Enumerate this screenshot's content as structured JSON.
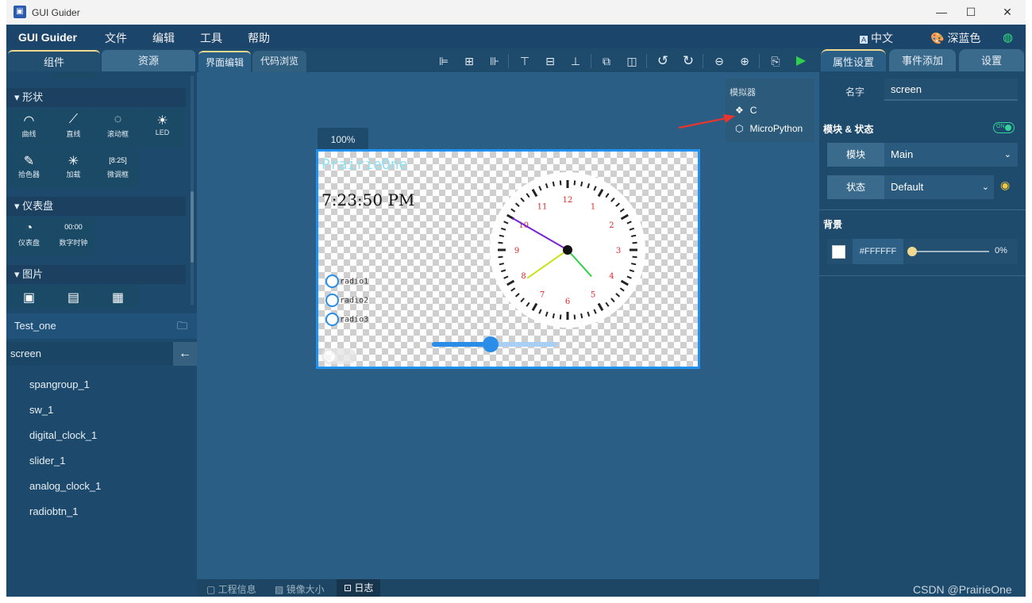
{
  "window": {
    "title": "GUI Guider",
    "icon": "app-logo-icon"
  },
  "menubar": {
    "brand": "GUI Guider",
    "items": [
      "文件",
      "编辑",
      "工具",
      "帮助"
    ],
    "language": "中文",
    "theme": "深蓝色"
  },
  "left_panel": {
    "tabs": [
      "组件",
      "资源"
    ],
    "sections": [
      {
        "title": "形状",
        "items": [
          "曲线",
          "直线",
          "滚动框",
          "LED",
          "拾色器",
          "加载",
          "微调框"
        ]
      },
      {
        "title": "仪表盘",
        "items": [
          "仪表盘",
          "数字时钟"
        ]
      },
      {
        "title": "图片",
        "items": [
          "",
          "",
          ""
        ]
      }
    ],
    "project": "Test_one",
    "screen": "screen",
    "tree": [
      "spangroup_1",
      "sw_1",
      "digital_clock_1",
      "slider_1",
      "analog_clock_1",
      "radiobtn_1"
    ]
  },
  "center": {
    "tabs": [
      "界面编辑",
      "代码浏览"
    ],
    "simulator": {
      "header": "模拟器",
      "options": [
        "C",
        "MicroPython"
      ]
    },
    "zoom": "100%",
    "canvas": {
      "spangroup": "PrairieOne",
      "digital_clock": "7:23:50 PM",
      "radios": [
        "radio1",
        "radio2",
        "radio3"
      ],
      "slider_value_fraction": 0.47,
      "clock_numbers": [
        "12",
        "1",
        "2",
        "3",
        "4",
        "5",
        "6",
        "7",
        "8",
        "9",
        "10",
        "11"
      ],
      "clock_time": {
        "hour": 7,
        "minute": 50,
        "second": 23
      }
    },
    "status": [
      "工程信息",
      "镜像大小",
      "日志"
    ]
  },
  "right_panel": {
    "tabs": [
      "属性设置",
      "事件添加",
      "设置"
    ],
    "name_label": "名字",
    "name_value": "screen",
    "module_state_header": "模块 & 状态",
    "toggle_text": "ON",
    "module_label": "模块",
    "module_value": "Main",
    "state_label": "状态",
    "state_value": "Default",
    "background_header": "背景",
    "bg_color": "#FFFFFF",
    "bg_opacity": "0%"
  },
  "watermark": "CSDN @PrairieOne",
  "colors": {
    "accent": "#2091f0",
    "panel": "#1e4a6b",
    "workspace": "#2a5e85"
  }
}
